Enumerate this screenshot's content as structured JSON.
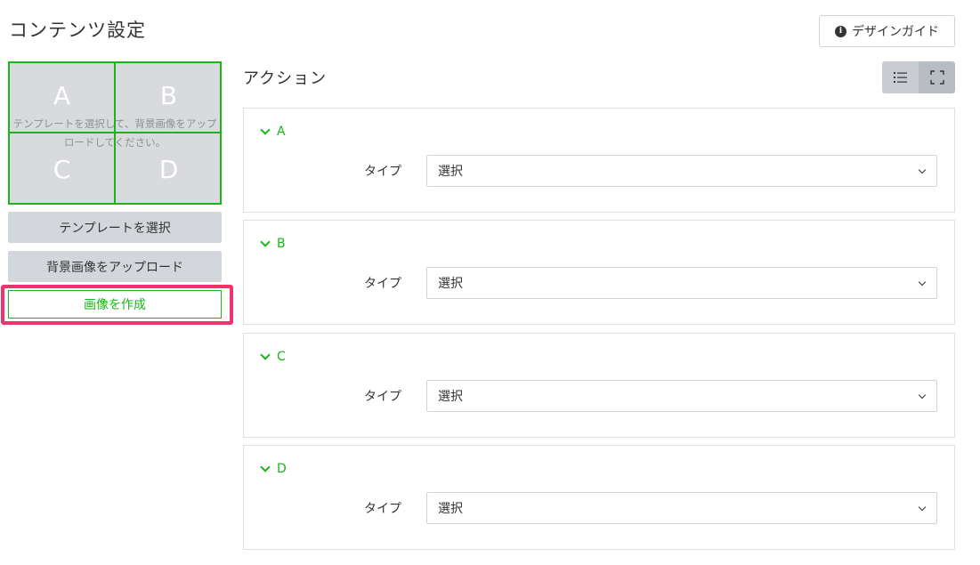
{
  "header": {
    "title": "コンテンツ設定",
    "guide_button": {
      "label": "デザインガイド",
      "icon": "info-icon"
    }
  },
  "preview": {
    "cells": [
      "A",
      "B",
      "C",
      "D"
    ],
    "hint": "テンプレートを選択して、背景画像をアップロードしてください。"
  },
  "sidebar": {
    "template_button": "テンプレートを選択",
    "upload_button": "背景画像をアップロード",
    "create_button": "画像を作成",
    "accent_color": "#19b51b",
    "highlight_color": "#f0336c"
  },
  "actions": {
    "title": "アクション",
    "view_toggle": [
      "list-icon",
      "expand-icon"
    ],
    "items": [
      {
        "name": "A",
        "type_label": "タイプ",
        "type_value": "選択"
      },
      {
        "name": "B",
        "type_label": "タイプ",
        "type_value": "選択"
      },
      {
        "name": "C",
        "type_label": "タイプ",
        "type_value": "選択"
      },
      {
        "name": "D",
        "type_label": "タイプ",
        "type_value": "選択"
      }
    ]
  }
}
